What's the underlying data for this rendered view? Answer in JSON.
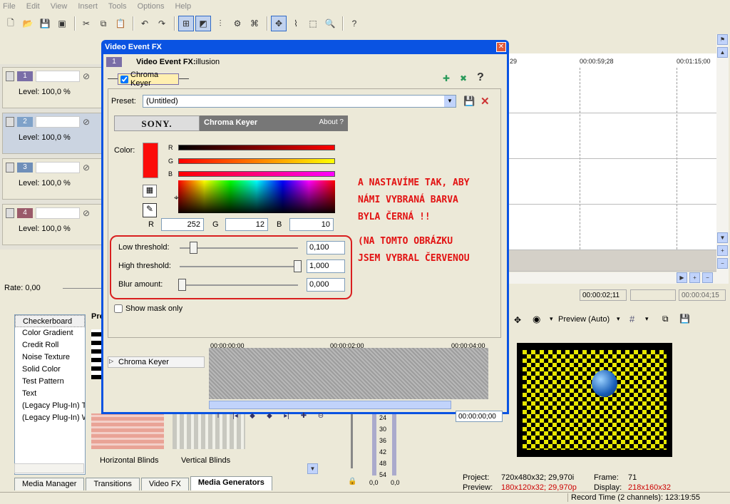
{
  "menu": [
    "File",
    "Edit",
    "View",
    "Insert",
    "Tools",
    "Options",
    "Help"
  ],
  "tracks": [
    {
      "num": "1",
      "level": "Level: 100,0 %",
      "color": "#7a6ea7"
    },
    {
      "num": "2",
      "level": "Level: 100,0 %",
      "color": "#7fa2c9"
    },
    {
      "num": "3",
      "level": "Level: 100,0 %",
      "color": "#6f8fb9"
    },
    {
      "num": "4",
      "level": "Level: 100,0 %",
      "color": "#9a5a6a"
    }
  ],
  "timeline": {
    "codes": [
      "29",
      "00:00:59;28",
      "00:01:15;00"
    ]
  },
  "rate": "Rate: 0,00",
  "right_tc": {
    "a": "00:00:02;11",
    "b": "00:00:04;15"
  },
  "generators": [
    "Checkerboard",
    "Color Gradient",
    "Credit Roll",
    "Noise Texture",
    "Solid Color",
    "Test Pattern",
    "Text",
    "(Legacy Plug-In) T",
    "(Legacy Plug-In) W"
  ],
  "thumbs": {
    "a": "Horizontal Blinds",
    "b": "Vertical Blinds",
    "pr": "Pre"
  },
  "tabs": [
    "Media Manager",
    "Transitions",
    "Video FX",
    "Media Generators"
  ],
  "mixer": {
    "ticks": [
      "24",
      "30",
      "36",
      "42",
      "48",
      "54"
    ],
    "l": "0,0",
    "r": "0,0"
  },
  "preview": {
    "mode": "Preview (Auto)",
    "project_label": "Project:",
    "project": "720x480x32; 29,970i",
    "preview_label": "Preview:",
    "preview": "180x120x32; 29,970p",
    "frame_label": "Frame:",
    "frame": "71",
    "display_label": "Display:",
    "display": "218x160x32"
  },
  "status": "Record Time (2 channels): 123:19:55",
  "dialog": {
    "title": "Video Event FX",
    "num": "1",
    "header_bold": "Video Event FX:",
    "header_rest": " illusion",
    "chain_item": "Chroma Keyer",
    "preset_label": "Preset:",
    "preset_value": "(Untitled)",
    "sony": "SONY.",
    "plugin": "Chroma Keyer",
    "about": "About  ?",
    "color_label": "Color:",
    "slider_labels": {
      "r": "R",
      "g": "G",
      "b": "B"
    },
    "rgb": {
      "r_label": "R",
      "r": "252",
      "g_label": "G",
      "g": "12",
      "b_label": "B",
      "b": "10"
    },
    "low_label": "Low threshold:",
    "low": "0,100",
    "high_label": "High threshold:",
    "high": "1,000",
    "blur_label": "Blur amount:",
    "blur": "0,000",
    "mask_label": "Show mask only",
    "kf_label": "Chroma Keyer",
    "kf_ruler": [
      "00:00:00;00",
      "00:00:02;00",
      "00:00:04;00"
    ],
    "kf_time": "00:00:00;00"
  },
  "annotation": {
    "line1": "A nastavíme tak, aby",
    "line2": "námi vybraná barva",
    "line3": "byla černá !!",
    "line4": "(na tomto obrázku",
    "line5": "jsem vybral červenou"
  },
  "colors": {
    "key_color": "#fc0c0a",
    "annotation": "#e21212",
    "title_bar": "#0a53e2"
  }
}
